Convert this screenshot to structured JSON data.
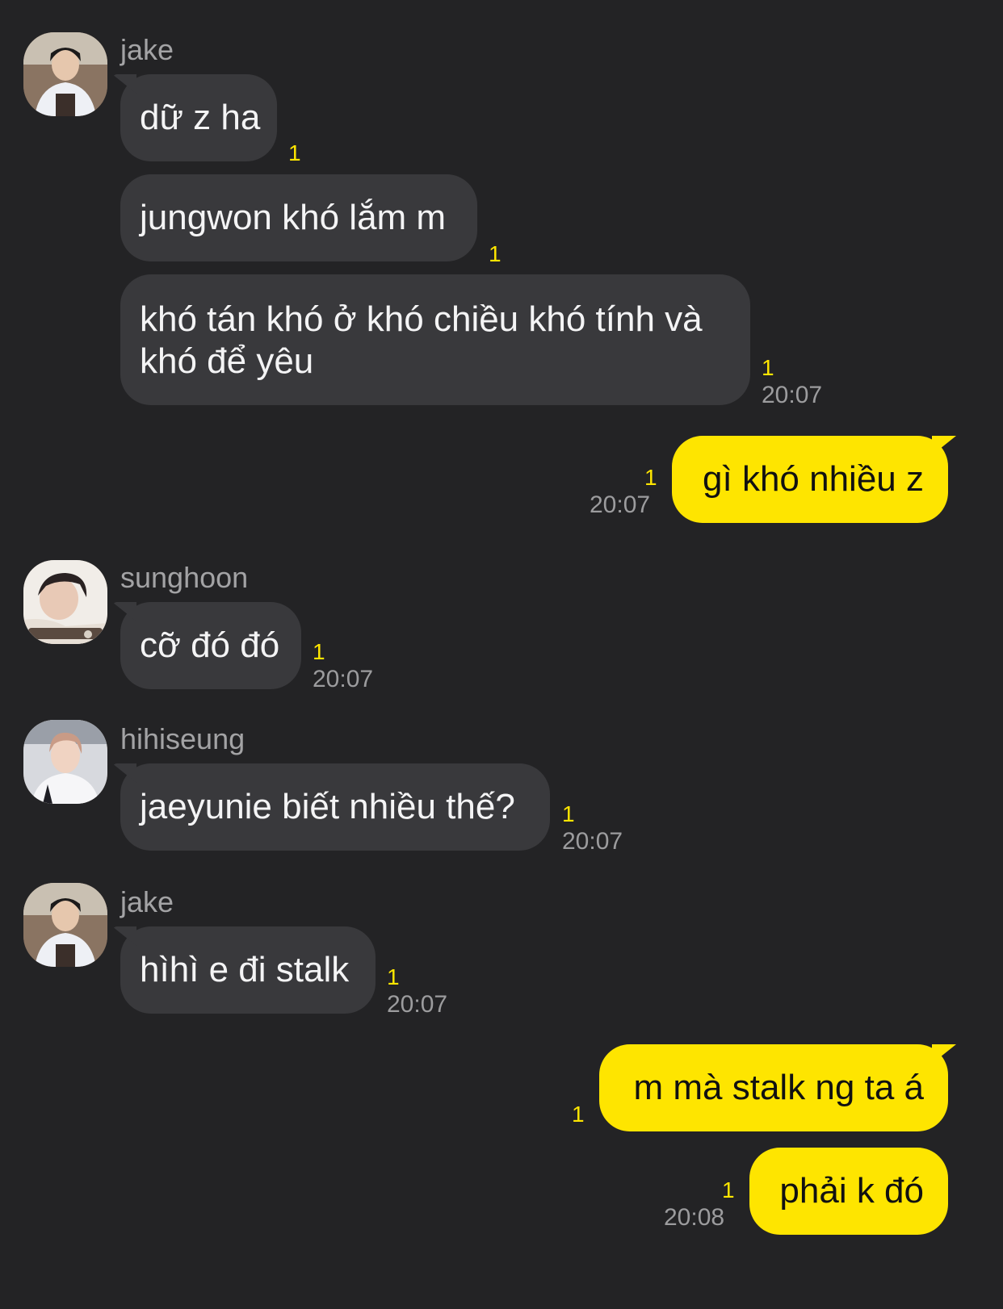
{
  "colors": {
    "background": "#232325",
    "incoming_bubble": "#39393c",
    "outgoing_bubble": "#fee500",
    "unread": "#fee500"
  },
  "groups": [
    {
      "sender": "jake",
      "avatar_icon": "jake-avatar",
      "messages": [
        {
          "text": "dữ z ha",
          "unread": "1"
        },
        {
          "text": "jungwon khó lắm m",
          "unread": "1"
        },
        {
          "text": "khó tán khó ở khó chiều khó tính và khó để yêu",
          "unread": "1",
          "time": "20:07"
        }
      ]
    },
    {
      "sender": "me",
      "messages": [
        {
          "text": "gì khó nhiều z",
          "unread": "1",
          "time": "20:07"
        }
      ]
    },
    {
      "sender": "sunghoon",
      "avatar_icon": "sunghoon-avatar",
      "messages": [
        {
          "text": "cỡ đó đó",
          "unread": "1",
          "time": "20:07"
        }
      ]
    },
    {
      "sender": "hihiseung",
      "avatar_icon": "hihiseung-avatar",
      "messages": [
        {
          "text": "jaeyunie biết nhiều thế?",
          "unread": "1",
          "time": "20:07"
        }
      ]
    },
    {
      "sender": "jake",
      "avatar_icon": "jake-avatar",
      "messages": [
        {
          "text": "hìhì e đi stalk",
          "unread": "1",
          "time": "20:07"
        }
      ]
    },
    {
      "sender": "me",
      "messages": [
        {
          "text": "m mà stalk ng ta á",
          "unread": "1"
        },
        {
          "text": "phải k đó",
          "unread": "1",
          "time": "20:08"
        }
      ]
    }
  ]
}
